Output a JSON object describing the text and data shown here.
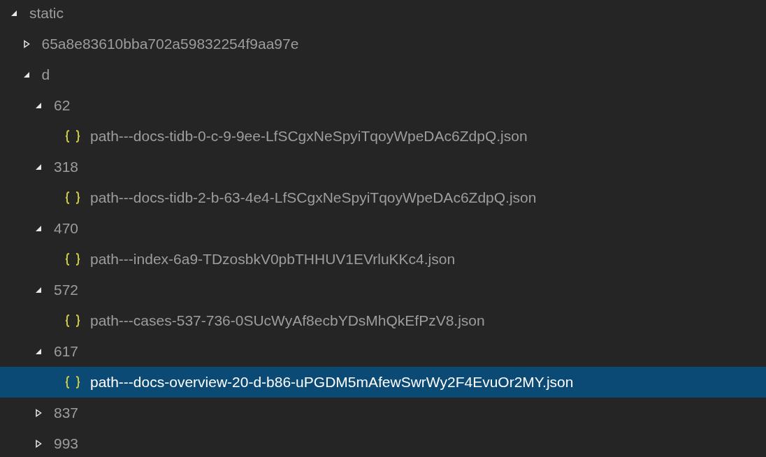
{
  "tree": [
    {
      "kind": "folder",
      "label": "static",
      "expanded": true,
      "selected": false,
      "children": [
        {
          "kind": "folder",
          "label": "65a8e83610bba702a59832254f9aa97e",
          "expanded": false,
          "selected": false
        },
        {
          "kind": "folder",
          "label": "d",
          "expanded": true,
          "selected": false,
          "children": [
            {
              "kind": "folder",
              "label": "62",
              "expanded": true,
              "selected": false,
              "children": [
                {
                  "kind": "file",
                  "label": "path---docs-tidb-0-c-9-9ee-LfSCgxNeSpyiTqoyWpeDAc6ZdpQ.json",
                  "selected": false
                }
              ]
            },
            {
              "kind": "folder",
              "label": "318",
              "expanded": true,
              "selected": false,
              "children": [
                {
                  "kind": "file",
                  "label": "path---docs-tidb-2-b-63-4e4-LfSCgxNeSpyiTqoyWpeDAc6ZdpQ.json",
                  "selected": false
                }
              ]
            },
            {
              "kind": "folder",
              "label": "470",
              "expanded": true,
              "selected": false,
              "children": [
                {
                  "kind": "file",
                  "label": "path---index-6a9-TDzosbkV0pbTHHUV1EVrluKKc4.json",
                  "selected": false
                }
              ]
            },
            {
              "kind": "folder",
              "label": "572",
              "expanded": true,
              "selected": false,
              "children": [
                {
                  "kind": "file",
                  "label": "path---cases-537-736-0SUcWyAf8ecbYDsMhQkEfPzV8.json",
                  "selected": false
                }
              ]
            },
            {
              "kind": "folder",
              "label": "617",
              "expanded": true,
              "selected": false,
              "children": [
                {
                  "kind": "file",
                  "label": "path---docs-overview-20-d-b86-uPGDM5mAfewSwrWy2F4EvuOr2MY.json",
                  "selected": true
                }
              ]
            },
            {
              "kind": "folder",
              "label": "837",
              "expanded": false,
              "selected": false
            },
            {
              "kind": "folder",
              "label": "993",
              "expanded": false,
              "selected": false
            }
          ]
        }
      ]
    }
  ]
}
